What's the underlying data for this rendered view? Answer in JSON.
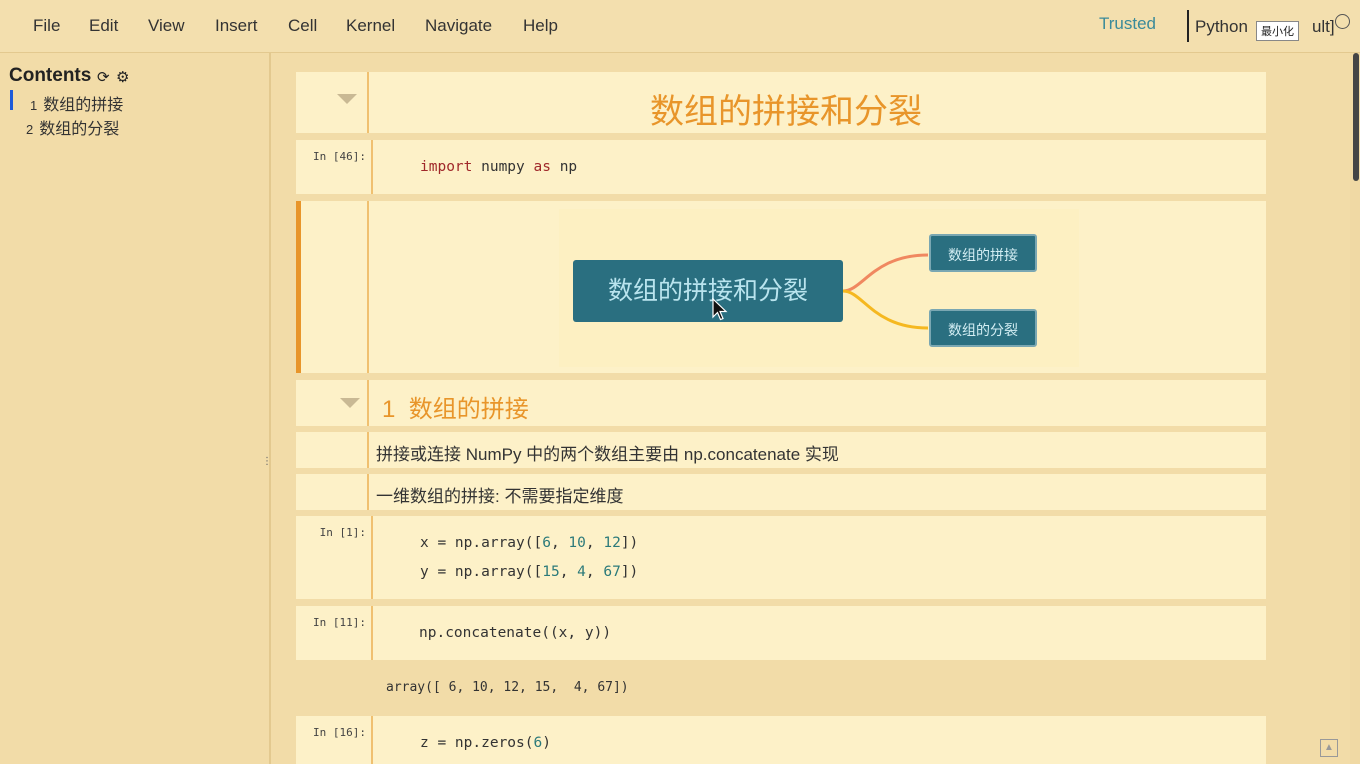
{
  "menubar": {
    "items": [
      "File",
      "Edit",
      "View",
      "Insert",
      "Cell",
      "Kernel",
      "Navigate",
      "Help"
    ],
    "trusted": "Trusted",
    "kernel_name": "Python",
    "tooltip": "最小化",
    "kernel_tail": "ult]"
  },
  "toc": {
    "title": "Contents",
    "items": [
      {
        "num": "1",
        "label": "数组的拼接"
      },
      {
        "num": "2",
        "label": "数组的分裂"
      }
    ]
  },
  "cells": {
    "heading_title": "数组的拼接和分裂",
    "import": {
      "prompt": "In [46]:",
      "kw1": "import",
      "mod": " numpy ",
      "kw2": "as",
      "alias": " np"
    },
    "mindmap": {
      "root": "数组的拼接和分裂",
      "child1": "数组的拼接",
      "child2": "数组的分裂",
      "line_colors": [
        "#f08860",
        "#f5b820"
      ]
    },
    "section1": {
      "num": "1",
      "title": "数组的拼接"
    },
    "md1": "拼接或连接 NumPy 中的两个数组主要由 np.concatenate 实现",
    "md2": "一维数组的拼接: 不需要指定维度",
    "cell_in1": {
      "prompt": "In [1]:",
      "x_pre": "x = np.array([",
      "x1": "6",
      "x2": "10",
      "x3": "12",
      "x_post": "])",
      "y_pre": "y = np.array([",
      "y1": "15",
      "y2": "4",
      "y3": "67",
      "y_post": "])"
    },
    "cell_in11": {
      "prompt": "In [11]:",
      "code": "np.concatenate((x, y))"
    },
    "output11": "array([ 6, 10, 12, 15,  4, 67])",
    "cell_in16": {
      "prompt": "In [16]:",
      "pre": "z = np.zeros(",
      "arg": "6",
      "post": ")"
    }
  },
  "colors": {
    "accent": "#e8952a",
    "teal": "#2a6f80",
    "trusted": "#3a8a9a"
  }
}
